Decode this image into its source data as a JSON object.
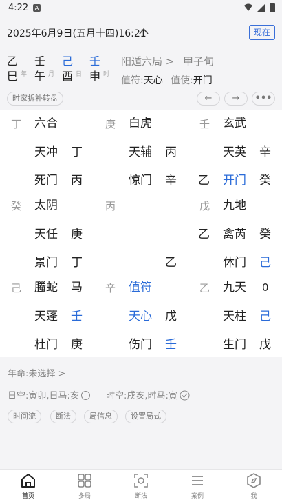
{
  "status": {
    "time": "4:22",
    "notif_icon": "A"
  },
  "header": {
    "date": "2025年6月9日(五月十四)16:21",
    "now_button": "现在"
  },
  "pillars": {
    "year": {
      "gan": "乙",
      "zhi": "巳",
      "label": "年"
    },
    "month": {
      "gan": "壬",
      "zhi": "午",
      "label": "月"
    },
    "day": {
      "gan": "己",
      "zhi": "酉",
      "label": "日"
    },
    "hour": {
      "gan": "壬",
      "zhi": "申",
      "label": "时"
    },
    "ju": "阳遁六局 >",
    "xun": "甲子旬",
    "zhifu_label": "值符:",
    "zhifu_value": "天心",
    "zhishi_label": "值使:",
    "zhishi_value": "开门",
    "method_pill": "时家拆补转盘"
  },
  "palaces": [
    {
      "stem": "丁",
      "god": "六合",
      "star": "天冲",
      "star_stem": "丁",
      "door": "死门",
      "door_stem": "丙",
      "extra": ""
    },
    {
      "stem": "庚",
      "god": "白虎",
      "star": "天辅",
      "star_stem": "丙",
      "door": "惊门",
      "door_stem": "辛",
      "extra": ""
    },
    {
      "stem": "壬",
      "god": "玄武",
      "star": "天英",
      "star_stem": "辛",
      "door": "开门",
      "door_stem": "癸",
      "extra": "乙"
    },
    {
      "stem": "癸",
      "god": "太阴",
      "star": "天任",
      "star_stem": "庚",
      "door": "景门",
      "door_stem": "丁",
      "extra": ""
    },
    {
      "stem": "丙",
      "god": "",
      "star": "",
      "star_stem": "",
      "door": "",
      "door_stem": "乙",
      "extra": ""
    },
    {
      "stem": "戊",
      "god": "九地",
      "star": "禽芮",
      "star_stem": "癸",
      "door": "休门",
      "door_stem": "己",
      "extra": "乙"
    },
    {
      "stem": "己",
      "god": "螣蛇",
      "star": "天蓬",
      "star_stem": "壬",
      "door": "杜门",
      "door_stem": "庚",
      "extra": "",
      "god_mark": "马"
    },
    {
      "stem": "辛",
      "god": "值符",
      "star": "天心",
      "star_stem": "戊",
      "door": "伤门",
      "door_stem": "壬",
      "extra": ""
    },
    {
      "stem": "乙",
      "god": "九天",
      "star": "天柱",
      "star_stem": "己",
      "door": "生门",
      "door_stem": "戊",
      "extra": "",
      "god_mark": "0"
    }
  ],
  "lower": {
    "nianming": "年命:未选择 >",
    "rikong": "日空:寅卯,日马:亥",
    "shikong": "时空:戌亥,时马:寅",
    "buttons": [
      "时间流",
      "断法",
      "局信息",
      "设置局式"
    ]
  },
  "tabs": [
    "首页",
    "多局",
    "断法",
    "案例",
    "我"
  ],
  "colors": {
    "accent": "#2a6bd8"
  }
}
